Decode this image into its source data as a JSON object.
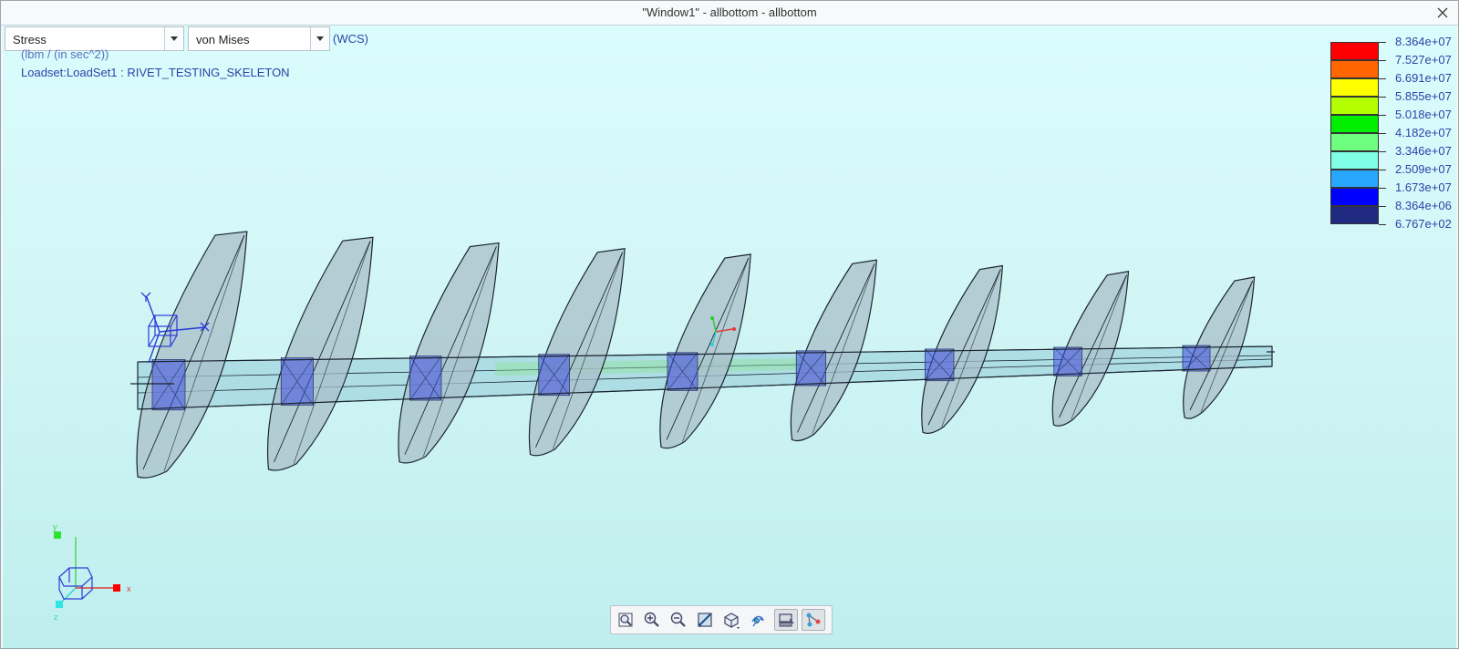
{
  "window": {
    "title": "\"Window1\" - allbottom - allbottom",
    "close_symbol": "✕"
  },
  "controls": {
    "result_quantity": "Stress",
    "component": "von Mises",
    "coordinate_system": "(WCS)"
  },
  "info": {
    "units": "(lbm / (in sec^2))",
    "loadset": "Loadset:LoadSet1 :  RIVET_TESTING_SKELETON"
  },
  "legend": {
    "labels": [
      "8.364e+07",
      "7.527e+07",
      "6.691e+07",
      "5.855e+07",
      "5.018e+07",
      "4.182e+07",
      "3.346e+07",
      "2.509e+07",
      "1.673e+07",
      "8.364e+06",
      "6.767e+02"
    ],
    "colors": [
      "#ff0000",
      "#ff6600",
      "#ffff00",
      "#b3ff00",
      "#00ee00",
      "#6fff80",
      "#80ffe6",
      "#29a7ff",
      "#0000ff",
      "#1f2a80"
    ]
  },
  "triad": {
    "x_label": "x",
    "y_label": "y",
    "z_label": "z"
  },
  "toolbar": {
    "buttons": [
      "refit-icon",
      "zoom-in-icon",
      "zoom-out-icon",
      "pan-zoom-icon",
      "view-orient-icon",
      "spin-center-icon",
      "display-style-icon",
      "datum-display-icon"
    ]
  },
  "colors": {
    "viewport_bg_top": "#dafcfd",
    "viewport_bg_bottom": "#bfeeee",
    "model_edge": "#1a2530",
    "rib_fill": "#a9bfc9",
    "spar_fill": "#9fd4df",
    "stress_low": "#3f4ee0"
  }
}
